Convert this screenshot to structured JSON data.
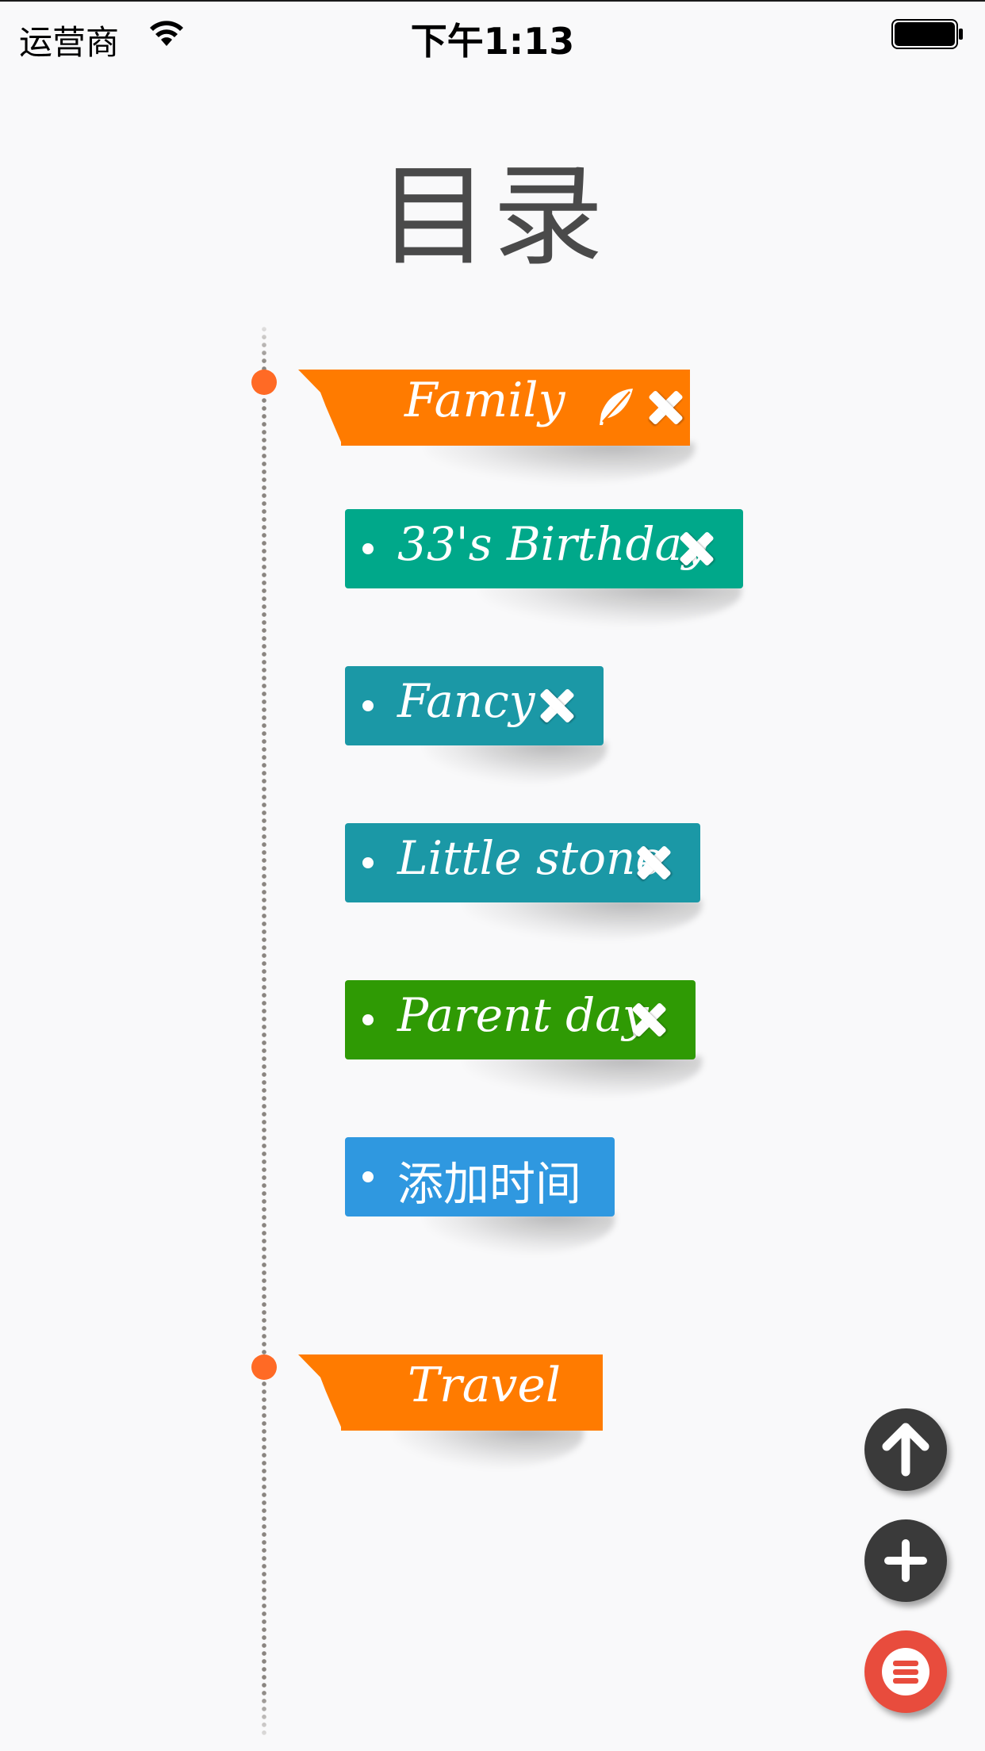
{
  "status_bar": {
    "carrier": "运营商",
    "time": "下午1:13"
  },
  "title": "目录",
  "colors": {
    "category": "#ff7b00",
    "timeline_dot": "#ff6a25",
    "fab_dark": "#3a3a3a",
    "fab_menu": "#e84c3d"
  },
  "categories": [
    {
      "label": "Family",
      "icons": [
        "feather-icon",
        "close-icon"
      ],
      "events": [
        {
          "label": "33's Birthday",
          "color": "#00a88a",
          "icon": "close-icon"
        },
        {
          "label": "Fancy",
          "color": "#1b98a6",
          "icon": "close-icon"
        },
        {
          "label": "Little stone",
          "color": "#1b98a6",
          "icon": "close-icon"
        },
        {
          "label": "Parent day",
          "color": "#2f9a04",
          "icon": "close-icon"
        },
        {
          "label": "添加时间",
          "color": "#2f98e0"
        }
      ]
    },
    {
      "label": "Travel",
      "icons": [],
      "events": []
    }
  ],
  "fab_buttons": [
    {
      "name": "scroll-top-button",
      "icon": "arrow-up-icon"
    },
    {
      "name": "add-button",
      "icon": "plus-icon"
    },
    {
      "name": "menu-button",
      "icon": "menu-icon"
    }
  ]
}
